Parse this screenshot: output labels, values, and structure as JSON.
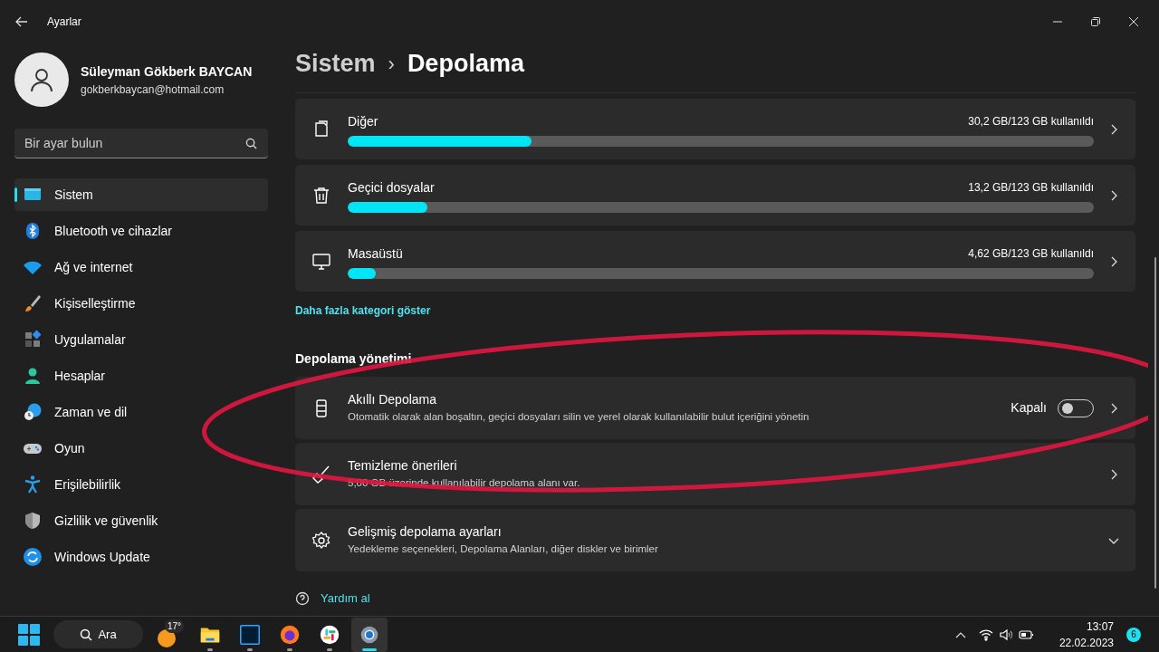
{
  "window": {
    "title": "Ayarlar"
  },
  "user": {
    "name": "Süleyman Gökberk BAYCAN",
    "email": "gokberkbaycan@hotmail.com"
  },
  "search": {
    "placeholder": "Bir ayar bulun"
  },
  "sidebar": {
    "items": [
      {
        "label": "Sistem",
        "selected": true
      },
      {
        "label": "Bluetooth ve cihazlar",
        "selected": false
      },
      {
        "label": "Ağ ve internet",
        "selected": false
      },
      {
        "label": "Kişiselleştirme",
        "selected": false
      },
      {
        "label": "Uygulamalar",
        "selected": false
      },
      {
        "label": "Hesaplar",
        "selected": false
      },
      {
        "label": "Zaman ve dil",
        "selected": false
      },
      {
        "label": "Oyun",
        "selected": false
      },
      {
        "label": "Erişilebilirlik",
        "selected": false
      },
      {
        "label": "Gizlilik ve güvenlik",
        "selected": false
      },
      {
        "label": "Windows Update",
        "selected": false
      }
    ]
  },
  "breadcrumb": {
    "parent": "Sistem",
    "separator": "›",
    "current": "Depolama"
  },
  "storage_categories": [
    {
      "label": "Diğer",
      "usage": "30,2 GB/123 GB kullanıldı",
      "level": 0.246
    },
    {
      "label": "Geçici dosyalar",
      "usage": "13,2 GB/123 GB kullanıldı",
      "level": 0.107
    },
    {
      "label": "Masaüstü",
      "usage": "4,62 GB/123 GB kullanıldı",
      "level": 0.038
    }
  ],
  "more_link": "Daha fazla kategori göster",
  "management": {
    "heading": "Depolama yönetimi",
    "items": [
      {
        "kind": "toggle",
        "title": "Akıllı Depolama",
        "subtitle": "Otomatik olarak alan boşaltın, geçici dosyaları silin ve yerel olarak kullanılabilir bulut içeriğini yönetin",
        "state_label": "Kapalı",
        "on": false
      },
      {
        "kind": "link",
        "title": "Temizleme önerileri",
        "subtitle": "5,00 GB üzerinde kullanılabilir depolama alanı var."
      },
      {
        "kind": "expander",
        "title": "Gelişmiş depolama ayarları",
        "subtitle": "Yedekleme seçenekleri, Depolama Alanları, diğer diskler ve birimler",
        "expanded": false
      }
    ]
  },
  "help_link": "Yardım al",
  "taskbar": {
    "search_label": "Ara",
    "weather": "17°",
    "apps": [
      {
        "running": true,
        "selected": false
      },
      {
        "running": true,
        "selected": false
      },
      {
        "running": true,
        "selected": false
      },
      {
        "running": true,
        "selected": false
      },
      {
        "running": true,
        "selected": true
      }
    ],
    "time": "13:07",
    "date": "22.02.2023",
    "notifications": "6"
  }
}
